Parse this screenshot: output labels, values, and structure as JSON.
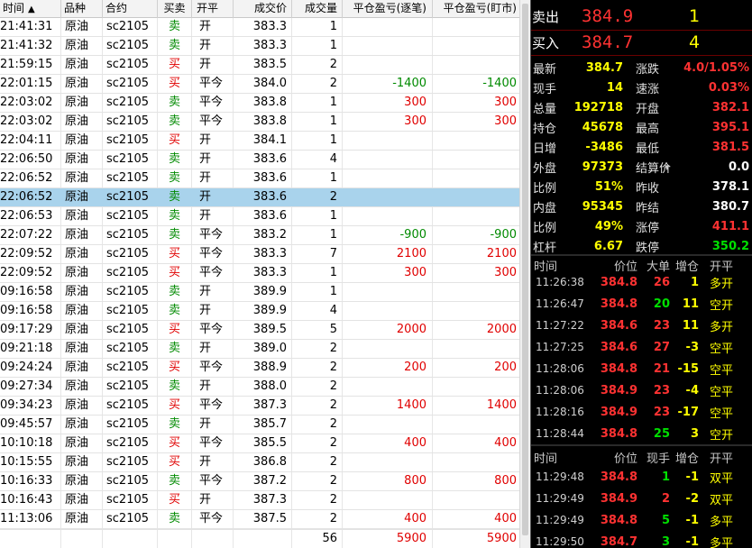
{
  "table": {
    "headers": [
      "时间",
      "品种",
      "合约",
      "买卖",
      "开平",
      "成交价",
      "成交量",
      "平仓盈亏(逐笔)",
      "平仓盈亏(盯市)"
    ],
    "sort_mark": "▲",
    "rows": [
      [
        "21:41:31",
        "原油",
        "sc2105",
        "卖",
        "开",
        "383.3",
        "1",
        "",
        ""
      ],
      [
        "21:41:32",
        "原油",
        "sc2105",
        "卖",
        "开",
        "383.3",
        "1",
        "",
        ""
      ],
      [
        "21:59:15",
        "原油",
        "sc2105",
        "买",
        "开",
        "383.5",
        "2",
        "",
        ""
      ],
      [
        "22:01:15",
        "原油",
        "sc2105",
        "买",
        "平今",
        "384.0",
        "2",
        "-1400",
        "-1400"
      ],
      [
        "22:03:02",
        "原油",
        "sc2105",
        "卖",
        "平今",
        "383.8",
        "1",
        "300",
        "300"
      ],
      [
        "22:03:02",
        "原油",
        "sc2105",
        "卖",
        "平今",
        "383.8",
        "1",
        "300",
        "300"
      ],
      [
        "22:04:11",
        "原油",
        "sc2105",
        "买",
        "开",
        "384.1",
        "1",
        "",
        ""
      ],
      [
        "22:06:50",
        "原油",
        "sc2105",
        "卖",
        "开",
        "383.6",
        "4",
        "",
        ""
      ],
      [
        "22:06:52",
        "原油",
        "sc2105",
        "卖",
        "开",
        "383.6",
        "1",
        "",
        ""
      ],
      [
        "22:06:52",
        "原油",
        "sc2105",
        "卖",
        "开",
        "383.6",
        "2",
        "",
        ""
      ],
      [
        "22:06:53",
        "原油",
        "sc2105",
        "卖",
        "开",
        "383.6",
        "1",
        "",
        ""
      ],
      [
        "22:07:22",
        "原油",
        "sc2105",
        "卖",
        "平今",
        "383.2",
        "1",
        "-900",
        "-900"
      ],
      [
        "22:09:52",
        "原油",
        "sc2105",
        "买",
        "平今",
        "383.3",
        "7",
        "2100",
        "2100"
      ],
      [
        "22:09:52",
        "原油",
        "sc2105",
        "买",
        "平今",
        "383.3",
        "1",
        "300",
        "300"
      ],
      [
        "09:16:58",
        "原油",
        "sc2105",
        "卖",
        "开",
        "389.9",
        "1",
        "",
        ""
      ],
      [
        "09:16:58",
        "原油",
        "sc2105",
        "卖",
        "开",
        "389.9",
        "4",
        "",
        ""
      ],
      [
        "09:17:29",
        "原油",
        "sc2105",
        "买",
        "平今",
        "389.5",
        "5",
        "2000",
        "2000"
      ],
      [
        "09:21:18",
        "原油",
        "sc2105",
        "卖",
        "开",
        "389.0",
        "2",
        "",
        ""
      ],
      [
        "09:24:24",
        "原油",
        "sc2105",
        "买",
        "平今",
        "388.9",
        "2",
        "200",
        "200"
      ],
      [
        "09:27:34",
        "原油",
        "sc2105",
        "卖",
        "开",
        "388.0",
        "2",
        "",
        ""
      ],
      [
        "09:34:23",
        "原油",
        "sc2105",
        "买",
        "平今",
        "387.3",
        "2",
        "1400",
        "1400"
      ],
      [
        "09:45:57",
        "原油",
        "sc2105",
        "卖",
        "开",
        "385.7",
        "2",
        "",
        ""
      ],
      [
        "10:10:18",
        "原油",
        "sc2105",
        "买",
        "平今",
        "385.5",
        "2",
        "400",
        "400"
      ],
      [
        "10:15:55",
        "原油",
        "sc2105",
        "买",
        "开",
        "386.8",
        "2",
        "",
        ""
      ],
      [
        "10:16:33",
        "原油",
        "sc2105",
        "卖",
        "平今",
        "387.2",
        "2",
        "800",
        "800"
      ],
      [
        "10:16:43",
        "原油",
        "sc2105",
        "买",
        "开",
        "387.3",
        "2",
        "",
        ""
      ],
      [
        "11:13:06",
        "原油",
        "sc2105",
        "卖",
        "平今",
        "387.5",
        "2",
        "400",
        "400"
      ]
    ],
    "selected_row": 9,
    "footer": {
      "volume": "56",
      "pnl_trade": "5900",
      "pnl_mark": "5900"
    }
  },
  "quote": {
    "ask": {
      "label": "卖出",
      "price": "384.9",
      "volume": "1"
    },
    "bid": {
      "label": "买入",
      "price": "384.7",
      "volume": "4"
    },
    "stats": [
      {
        "l1": "最新",
        "v1": "384.7",
        "l2": "涨跌",
        "v2": "4.0/1.05%",
        "c2": "#ff3232"
      },
      {
        "l1": "现手",
        "v1": "14",
        "l2": "速涨",
        "v2": "0.03%",
        "c2": "#ff3232"
      },
      {
        "l1": "总量",
        "v1": "192718",
        "l2": "开盘",
        "v2": "382.1",
        "c2": "#ff3232"
      },
      {
        "l1": "持仓",
        "v1": "45678",
        "l2": "最高",
        "v2": "395.1",
        "c2": "#ff3232"
      },
      {
        "l1": "日增",
        "v1": "-3486",
        "l2": "最低",
        "v2": "381.5",
        "c2": "#ff3232"
      },
      {
        "l1": "外盘",
        "v1": "97373",
        "l2": "结算价",
        "v2": "0.0",
        "c2": "#ffffff"
      },
      {
        "l1": "比例",
        "v1": "51%",
        "l2": "昨收",
        "v2": "378.1",
        "c2": "#ffffff"
      },
      {
        "l1": "内盘",
        "v1": "95345",
        "l2": "昨结",
        "v2": "380.7",
        "c2": "#ffffff"
      },
      {
        "l1": "比例",
        "v1": "49%",
        "l2": "涨停",
        "v2": "411.1",
        "c2": "#ff3232"
      },
      {
        "l1": "杠杆",
        "v1": "6.67",
        "l2": "跌停",
        "v2": "350.2",
        "c2": "#00e000"
      }
    ],
    "settle_dropdown_icon": "caret-down-icon"
  },
  "ticks_big": {
    "headers": [
      "时间",
      "价位",
      "大单",
      "增仓",
      "开平"
    ],
    "rows": [
      {
        "t": "11:26:38",
        "p": "384.8",
        "b": "26",
        "bc": "#ff3232",
        "z": "1",
        "zc": "#ffff00",
        "k": "多开"
      },
      {
        "t": "11:26:47",
        "p": "384.8",
        "b": "20",
        "bc": "#00e000",
        "z": "11",
        "zc": "#ffff00",
        "k": "空开"
      },
      {
        "t": "11:27:22",
        "p": "384.6",
        "b": "23",
        "bc": "#ff3232",
        "z": "11",
        "zc": "#ffff00",
        "k": "多开"
      },
      {
        "t": "11:27:25",
        "p": "384.6",
        "b": "27",
        "bc": "#ff3232",
        "z": "-3",
        "zc": "#ffff00",
        "k": "空平"
      },
      {
        "t": "11:28:06",
        "p": "384.8",
        "b": "21",
        "bc": "#ff3232",
        "z": "-15",
        "zc": "#ffff00",
        "k": "空平"
      },
      {
        "t": "11:28:06",
        "p": "384.9",
        "b": "23",
        "bc": "#ff3232",
        "z": "-4",
        "zc": "#ffff00",
        "k": "空平"
      },
      {
        "t": "11:28:16",
        "p": "384.9",
        "b": "23",
        "bc": "#ff3232",
        "z": "-17",
        "zc": "#ffff00",
        "k": "空平"
      },
      {
        "t": "11:28:44",
        "p": "384.8",
        "b": "25",
        "bc": "#00e000",
        "z": "3",
        "zc": "#ffff00",
        "k": "空开"
      }
    ]
  },
  "ticks_small": {
    "headers": [
      "时间",
      "价位",
      "现手",
      "增仓",
      "开平"
    ],
    "rows": [
      {
        "t": "11:29:48",
        "p": "384.8",
        "b": "1",
        "bc": "#00e000",
        "z": "-1",
        "zc": "#ffff00",
        "k": "双平"
      },
      {
        "t": "11:29:49",
        "p": "384.9",
        "b": "2",
        "bc": "#ff3232",
        "z": "-2",
        "zc": "#ffff00",
        "k": "双平"
      },
      {
        "t": "11:29:49",
        "p": "384.8",
        "b": "5",
        "bc": "#00e000",
        "z": "-1",
        "zc": "#ffff00",
        "k": "多平"
      },
      {
        "t": "11:29:50",
        "p": "384.7",
        "b": "3",
        "bc": "#00e000",
        "z": "-1",
        "zc": "#ffff00",
        "k": "多平"
      }
    ]
  },
  "colors": {
    "up": "#ff3232",
    "down": "#00e000",
    "buy_text": "#e00000",
    "sell_text": "#008a00",
    "selected_row": "#a9d3ec"
  }
}
